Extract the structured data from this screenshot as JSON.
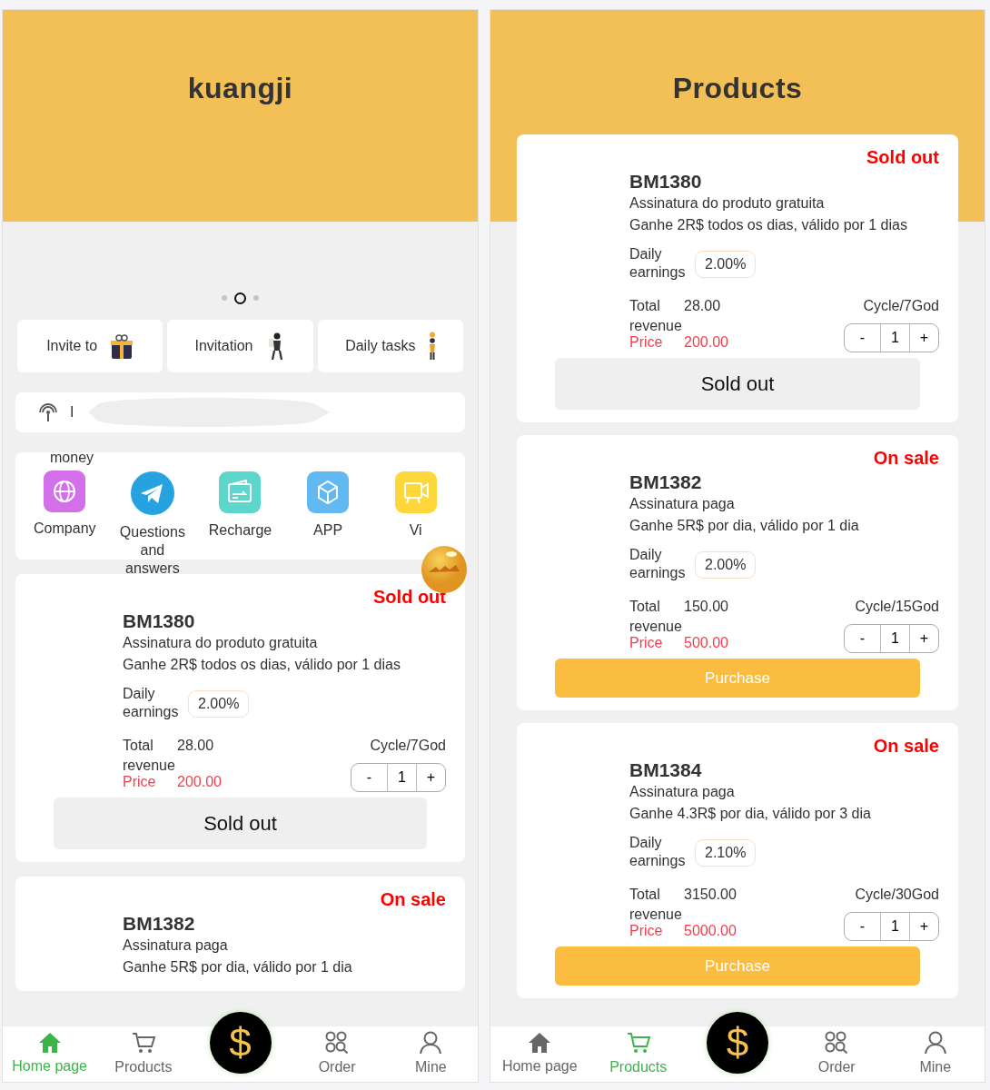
{
  "screens": [
    {
      "kind": "home",
      "title": "kuangji",
      "carousel": [
        {
          "selected": false
        },
        {
          "selected": true
        },
        {
          "selected": false
        }
      ],
      "quick_links": [
        {
          "label": "Invite to"
        },
        {
          "label": "Invitation"
        },
        {
          "label": "Daily tasks"
        }
      ],
      "notice": {
        "text": "I"
      },
      "shortcuts_caption": "money",
      "shortcuts": [
        {
          "label": "Company"
        },
        {
          "label": "Questions and answers"
        },
        {
          "label": "Recharge"
        },
        {
          "label": "APP"
        },
        {
          "label": "Vi"
        }
      ],
      "products": [
        {
          "status": "Sold out",
          "name": "BM1380",
          "subtitle": "Assinatura do produto gratuita",
          "description": "Ganhe 2R$ todos os dias, válido por 1 dias",
          "daily_label": "Daily earnings",
          "daily_rate": "2.00%",
          "total_label": "Total revenue",
          "total": "28.00",
          "cycle": "Cycle/7God",
          "price_label": "Price",
          "price": "200.00",
          "minus": "-",
          "quantity": "1",
          "plus": "+",
          "action": {
            "label": "Sold out",
            "disabled": true
          }
        },
        {
          "status": "On sale",
          "name": "BM1382",
          "subtitle": "Assinatura paga",
          "description": "Ganhe 5R$ por dia, válido por 1 dia"
        }
      ],
      "center_button": "$",
      "nav": [
        {
          "label": "Home page",
          "selected": true
        },
        {
          "label": "Products",
          "selected": false
        },
        {
          "label": "Order",
          "selected": false
        },
        {
          "label": "Mine",
          "selected": false
        }
      ]
    },
    {
      "kind": "products",
      "title": "Products",
      "products": [
        {
          "status": "Sold out",
          "name": "BM1380",
          "subtitle": "Assinatura do produto gratuita",
          "description": "Ganhe 2R$ todos os dias, válido por 1 dias",
          "daily_label": "Daily earnings",
          "daily_rate": "2.00%",
          "total_label": "Total revenue",
          "total": "28.00",
          "cycle": "Cycle/7God",
          "price_label": "Price",
          "price": "200.00",
          "minus": "-",
          "quantity": "1",
          "plus": "+",
          "action": {
            "label": "Sold out",
            "disabled": true
          }
        },
        {
          "status": "On sale",
          "name": "BM1382",
          "subtitle": "Assinatura paga",
          "description": "Ganhe 5R$ por dia, válido por 1 dia",
          "daily_label": "Daily earnings",
          "daily_rate": "2.00%",
          "total_label": "Total revenue",
          "total": "150.00",
          "cycle": "Cycle/15God",
          "price_label": "Price",
          "price": "500.00",
          "minus": "-",
          "quantity": "1",
          "plus": "+",
          "action": {
            "label": "Purchase",
            "disabled": false
          }
        },
        {
          "status": "On sale",
          "name": "BM1384",
          "subtitle": "Assinatura paga",
          "description": "Ganhe 4.3R$ por dia, válido por 3 dia",
          "daily_label": "Daily earnings",
          "daily_rate": "2.10%",
          "total_label": "Total revenue",
          "total": "3150.00",
          "cycle": "Cycle/30God",
          "price_label": "Price",
          "price": "5000.00",
          "minus": "-",
          "quantity": "1",
          "plus": "+",
          "action": {
            "label": "Purchase",
            "disabled": false
          }
        }
      ],
      "center_button": "$",
      "nav": [
        {
          "label": "Home page",
          "selected": false
        },
        {
          "label": "Products",
          "selected": true
        },
        {
          "label": "Order",
          "selected": false
        },
        {
          "label": "Mine",
          "selected": false
        }
      ]
    }
  ]
}
